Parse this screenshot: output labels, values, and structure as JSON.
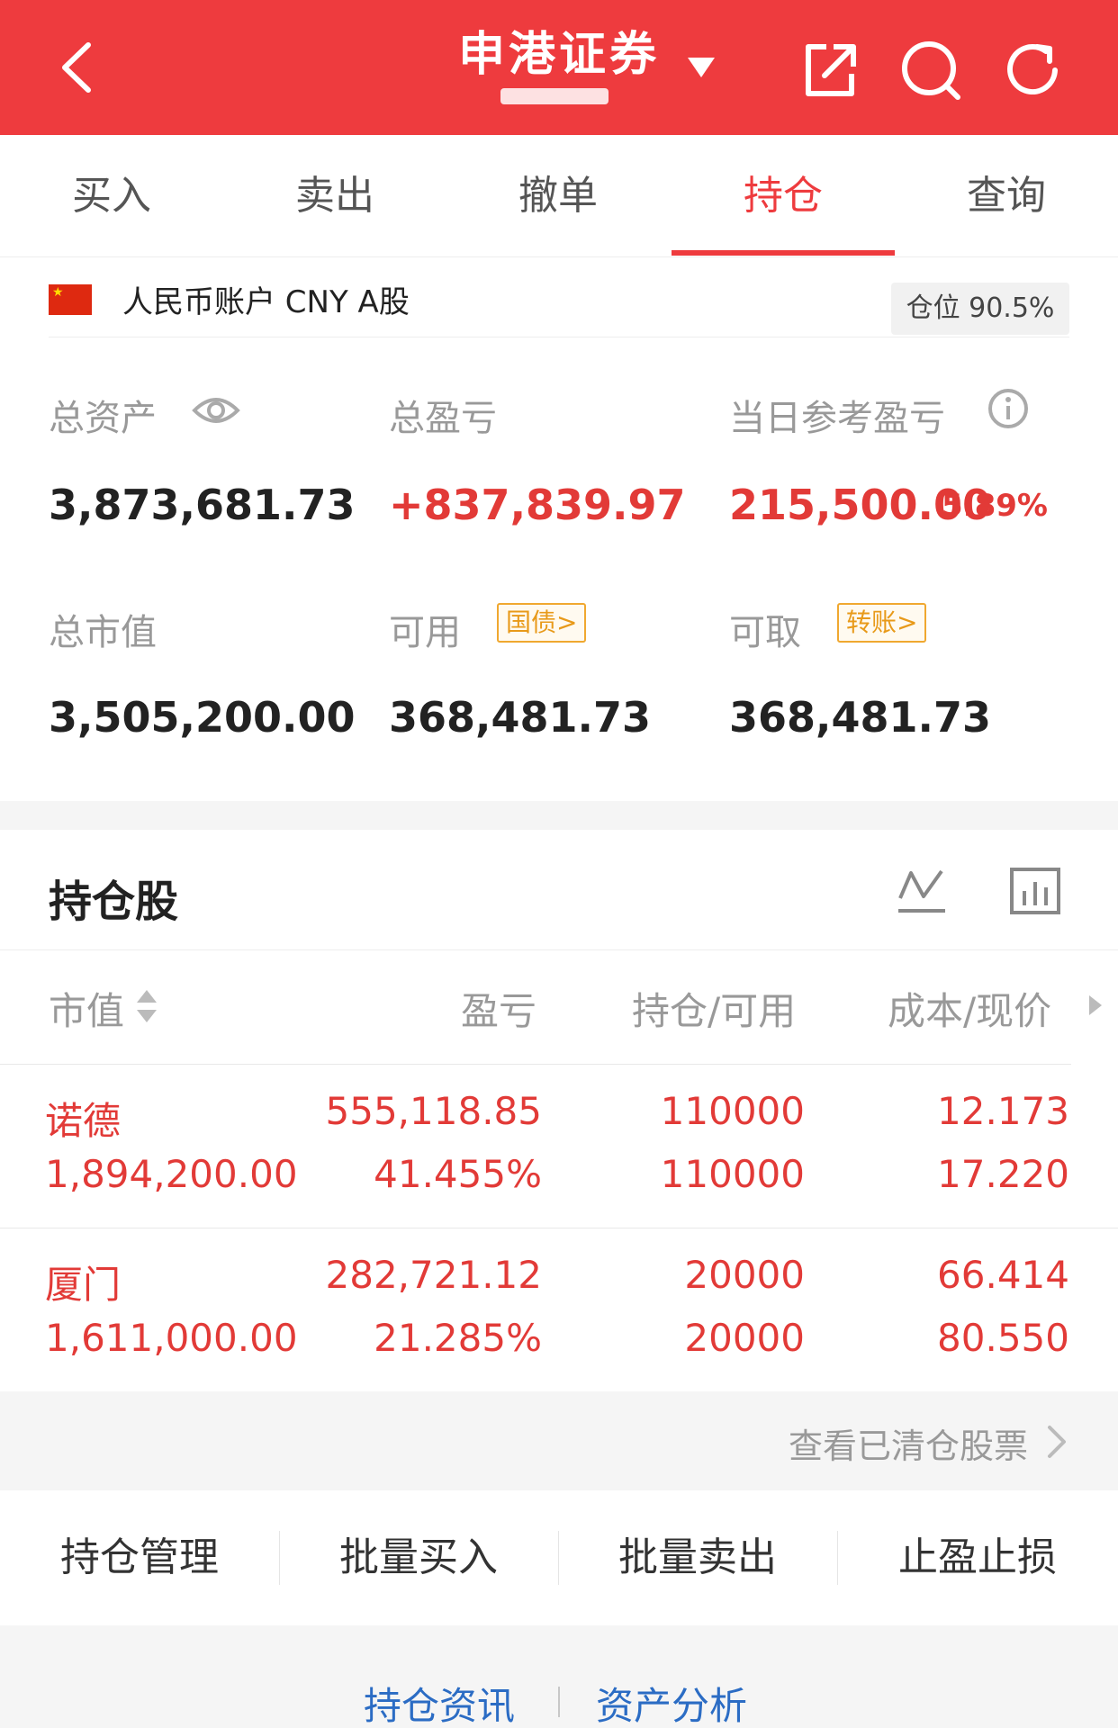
{
  "header": {
    "title": "申港证券",
    "back_icon": "chevron-left-icon",
    "share_icon": "share-external-icon",
    "search_icon": "search-icon",
    "refresh_icon": "refresh-icon",
    "accent": "#ee3b3e"
  },
  "tabs": [
    {
      "label": "买入"
    },
    {
      "label": "卖出"
    },
    {
      "label": "撤单"
    },
    {
      "label": "持仓",
      "active": true
    },
    {
      "label": "查询"
    }
  ],
  "account": {
    "label": "人民币账户 CNY A股",
    "position_badge": "仓位 90.5%"
  },
  "summary": {
    "total_assets_label": "总资产",
    "total_assets": "3,873,681.73",
    "total_pl_label": "总盈亏",
    "total_pl": "+837,839.97",
    "daily_pl_label": "当日参考盈亏",
    "daily_pl": "215,500.00",
    "daily_pl_pct": "5.89%",
    "market_value_label": "总市值",
    "market_value": "3,505,200.00",
    "available_label": "可用",
    "available_tag": "国债>",
    "available": "368,481.73",
    "withdrawable_label": "可取",
    "withdrawable_tag": "转账>",
    "withdrawable": "368,481.73"
  },
  "holdings": {
    "title": "持仓股",
    "columns": {
      "market_value": "市值",
      "pl": "盈亏",
      "position": "持仓/可用",
      "cost_price": "成本/现价"
    },
    "rows": [
      {
        "name": "诺德",
        "market_value": "1,894,200.00",
        "pl": "555,118.85",
        "pl_pct": "41.455%",
        "position": "110000",
        "available": "110000",
        "cost": "12.173",
        "price": "17.220"
      },
      {
        "name": "厦门",
        "market_value": "1,611,000.00",
        "pl": "282,721.12",
        "pl_pct": "21.285%",
        "position": "20000",
        "available": "20000",
        "cost": "66.414",
        "price": "80.550"
      }
    ],
    "cleared_link": "查看已清仓股票"
  },
  "actions": [
    {
      "label": "持仓管理"
    },
    {
      "label": "批量买入"
    },
    {
      "label": "批量卖出"
    },
    {
      "label": "止盈止损"
    }
  ],
  "footer": {
    "news": "持仓资讯",
    "analysis": "资产分析"
  }
}
